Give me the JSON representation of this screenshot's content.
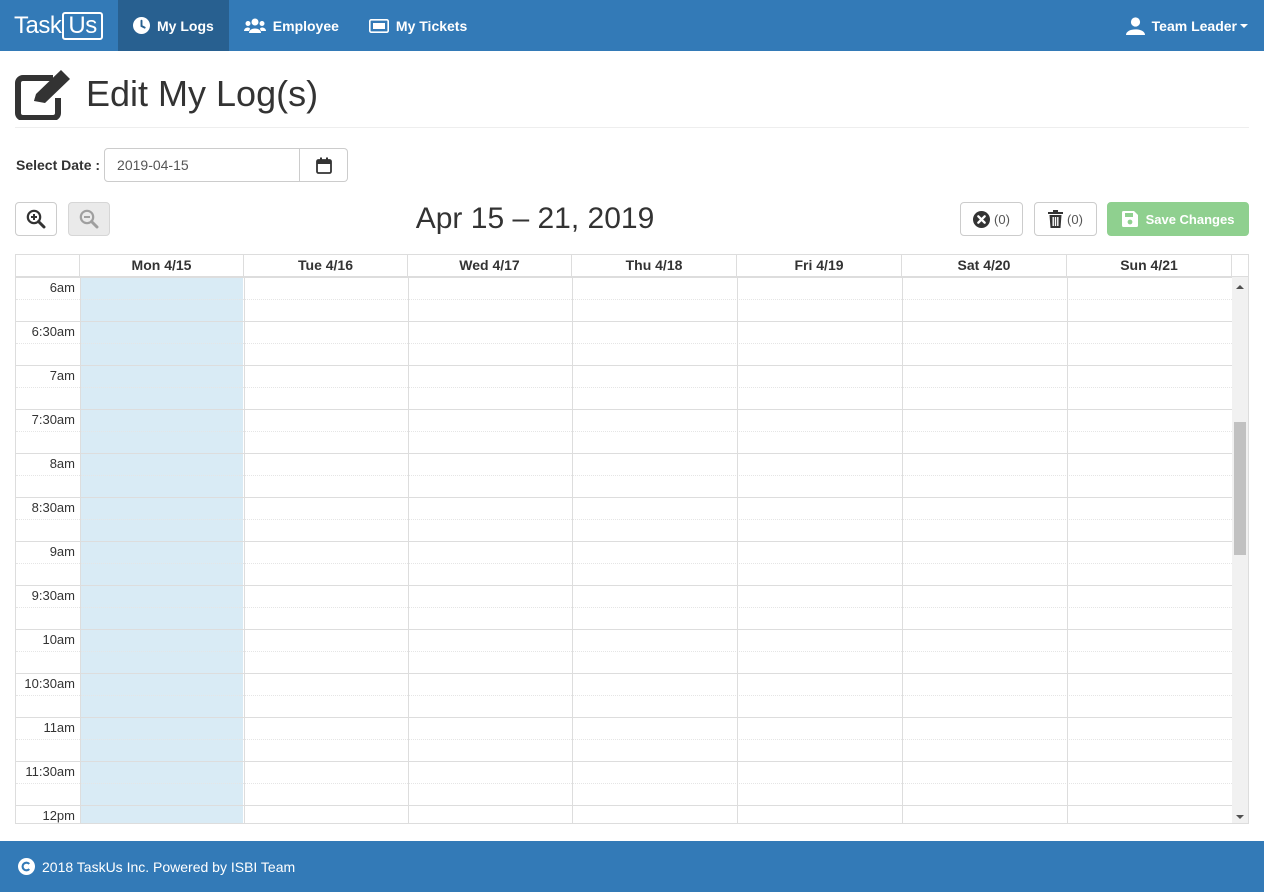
{
  "nav": {
    "brand_main": "Task",
    "brand_box": "Us",
    "items": [
      {
        "label": "My Logs",
        "icon": "clock-icon",
        "active": true
      },
      {
        "label": "Employee",
        "icon": "users-icon",
        "active": false
      },
      {
        "label": "My Tickets",
        "icon": "ticket-icon",
        "active": false
      }
    ],
    "user_label": "Team Leader"
  },
  "header": {
    "title": "Edit My Log(s)",
    "icon": "edit-icon"
  },
  "date_picker": {
    "label": "Select Date :",
    "value": "2019-04-15"
  },
  "toolbar": {
    "range_title": "Apr 15 – 21, 2019",
    "clear_count": "(0)",
    "delete_count": "(0)",
    "save_label": "Save Changes"
  },
  "calendar": {
    "days": [
      "Mon 4/15",
      "Tue 4/16",
      "Wed 4/17",
      "Thu 4/18",
      "Fri 4/19",
      "Sat 4/20",
      "Sun 4/21"
    ],
    "times": [
      "6am",
      "6:30am",
      "7am",
      "7:30am",
      "8am",
      "8:30am",
      "9am",
      "9:30am",
      "10am",
      "10:30am",
      "11am",
      "11:30am",
      "12pm"
    ],
    "today_index": 0,
    "today_color": "#d9ebf5"
  },
  "footer": {
    "text": "2018 TaskUs Inc. Powered by ISBI Team"
  },
  "colors": {
    "primary": "#337ab7",
    "success_disabled": "#8fd08f"
  }
}
